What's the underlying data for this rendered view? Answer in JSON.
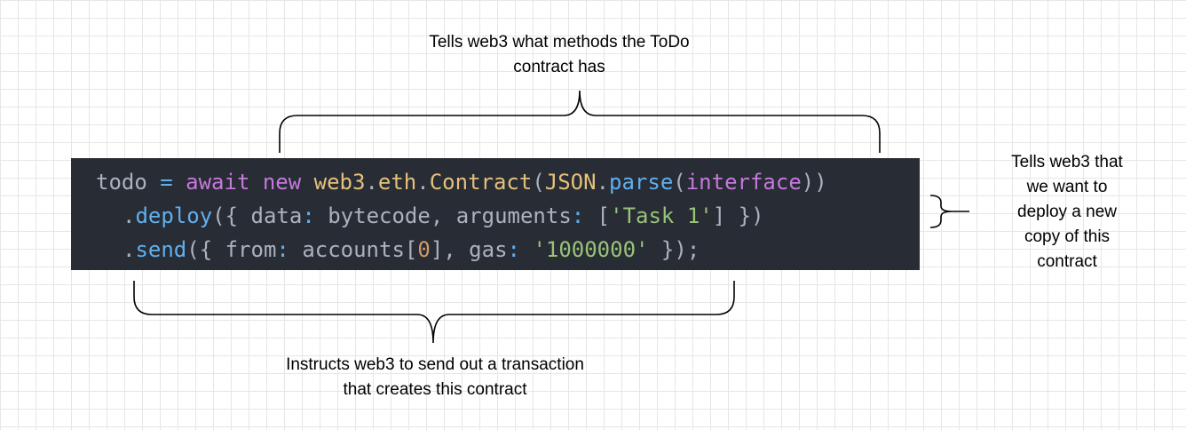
{
  "annotations": {
    "top": "Tells web3 what methods the ToDo\ncontract has",
    "right": "Tells web3 that\nwe want to\ndeploy a new\ncopy of this\ncontract",
    "bottom": "Instructs web3 to send out a transaction\nthat creates this contract"
  },
  "code": {
    "line1": [
      {
        "t": "todo ",
        "c": "plain"
      },
      {
        "t": "= ",
        "c": "func"
      },
      {
        "t": "await ",
        "c": "keyword"
      },
      {
        "t": "new ",
        "c": "keyword"
      },
      {
        "t": "web3",
        "c": "class"
      },
      {
        "t": ".",
        "c": "plain"
      },
      {
        "t": "eth",
        "c": "class"
      },
      {
        "t": ".",
        "c": "plain"
      },
      {
        "t": "Contract",
        "c": "class"
      },
      {
        "t": "(",
        "c": "plain"
      },
      {
        "t": "JSON",
        "c": "class"
      },
      {
        "t": ".",
        "c": "plain"
      },
      {
        "t": "parse",
        "c": "func"
      },
      {
        "t": "(",
        "c": "plain"
      },
      {
        "t": "interface",
        "c": "keyword"
      },
      {
        "t": "))",
        "c": "plain"
      }
    ],
    "line2": [
      {
        "t": ".",
        "c": "plain"
      },
      {
        "t": "deploy",
        "c": "func"
      },
      {
        "t": "({ ",
        "c": "plain"
      },
      {
        "t": "data",
        "c": "prop"
      },
      {
        "t": ": ",
        "c": "func"
      },
      {
        "t": "bytecode",
        "c": "plain"
      },
      {
        "t": ", ",
        "c": "plain"
      },
      {
        "t": "arguments",
        "c": "prop"
      },
      {
        "t": ": ",
        "c": "func"
      },
      {
        "t": "[",
        "c": "plain"
      },
      {
        "t": "'Task 1'",
        "c": "string"
      },
      {
        "t": "] })",
        "c": "plain"
      }
    ],
    "line3": [
      {
        "t": ".",
        "c": "plain"
      },
      {
        "t": "send",
        "c": "func"
      },
      {
        "t": "({ ",
        "c": "plain"
      },
      {
        "t": "from",
        "c": "prop"
      },
      {
        "t": ": ",
        "c": "func"
      },
      {
        "t": "accounts",
        "c": "plain"
      },
      {
        "t": "[",
        "c": "plain"
      },
      {
        "t": "0",
        "c": "number"
      },
      {
        "t": "], ",
        "c": "plain"
      },
      {
        "t": "gas",
        "c": "prop"
      },
      {
        "t": ": ",
        "c": "func"
      },
      {
        "t": "'1000000'",
        "c": "string"
      },
      {
        "t": " });",
        "c": "plain"
      }
    ]
  },
  "colors": {
    "code_background": "#282c34",
    "keyword": "#c678dd",
    "class": "#e5c07b",
    "function": "#61afef",
    "string": "#98c379",
    "number": "#d19a66",
    "plain": "#abb2bf"
  }
}
